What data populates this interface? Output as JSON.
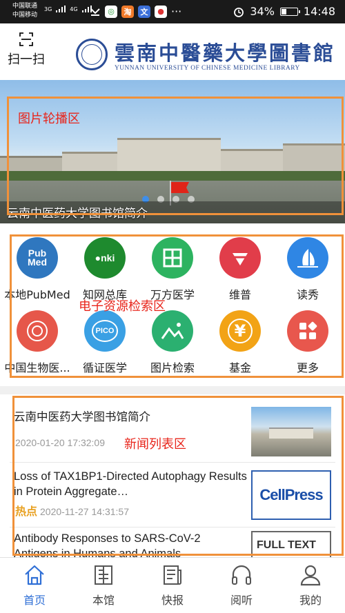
{
  "status_bar": {
    "carrier_1": "中国联通",
    "carrier_2": "中国移动",
    "net_1": "3G",
    "net_2": "4G",
    "battery": "34%",
    "battery_level": 0.34,
    "time": "14:48",
    "more": "···"
  },
  "header": {
    "scan_label": "扫一扫",
    "library_name": "雲南中醫藥大學圖書館",
    "library_name_en": "YUNNAN UNIVERSITY OF CHINESE MEDICINE LIBRARY"
  },
  "banner": {
    "caption": "云南中医药大学图书馆简介",
    "annotation": "图片轮播区",
    "slides": 4,
    "active_slide": 1
  },
  "resources": {
    "annotation": "电子资源检索区",
    "items": [
      {
        "label": "本地PubMed",
        "icon": "pubmed-icon",
        "text": "Pub Med",
        "color": "#2f77bf"
      },
      {
        "label": "知网总库",
        "icon": "cnki-icon",
        "text": "CNKI",
        "color": "#1e8a2e"
      },
      {
        "label": "万方医学",
        "icon": "wanfang-icon",
        "text": "",
        "color": "#2db360"
      },
      {
        "label": "维普",
        "icon": "vip-icon",
        "text": "",
        "color": "#e13d4a"
      },
      {
        "label": "读秀",
        "icon": "duxiu-icon",
        "text": "",
        "color": "#2f86e4"
      },
      {
        "label": "中国生物医...",
        "icon": "sinomed-icon",
        "text": "",
        "color": "#e6574a"
      },
      {
        "label": "循证医学",
        "icon": "pico-icon",
        "text": "PICO",
        "color": "#3aa0e4"
      },
      {
        "label": "图片检索",
        "icon": "image-search-icon",
        "text": "",
        "color": "#2bb070"
      },
      {
        "label": "基金",
        "icon": "fund-icon",
        "text": "¥",
        "color": "#f2a316"
      },
      {
        "label": "更多",
        "icon": "more-icon",
        "text": "",
        "color": "#e8574d"
      }
    ]
  },
  "news": {
    "annotation": "新闻列表区",
    "items": [
      {
        "title": "云南中医药大学图书馆简介",
        "date": "2020-01-20 17:32:09",
        "hot": "",
        "thumb": "campus-photo"
      },
      {
        "title": "Loss of TAX1BP1-Directed Autophagy Results in Protein Aggregate…",
        "date": "2020-11-27 14:31:57",
        "hot": "热点",
        "thumb": "cellpress-logo",
        "thumb_text": "CellPress"
      },
      {
        "title": "Antibody Responses to SARS-CoV-2 Antigens in Humans and Animals",
        "date": "",
        "hot": "",
        "thumb": "fulltext-logo",
        "thumb_text": "FULL TEXT"
      }
    ]
  },
  "tabbar": {
    "items": [
      {
        "label": "首页",
        "icon": "home-icon",
        "active": true
      },
      {
        "label": "本馆",
        "icon": "library-icon",
        "active": false
      },
      {
        "label": "快报",
        "icon": "newsletter-icon",
        "active": false
      },
      {
        "label": "阅听",
        "icon": "headphones-icon",
        "active": false
      },
      {
        "label": "我的",
        "icon": "profile-icon",
        "active": false
      }
    ]
  },
  "colors": {
    "accent": "#2f6fd6",
    "annotation_border": "#f0913a",
    "annotation_text": "#e8241a",
    "brand": "#2b4d96"
  }
}
